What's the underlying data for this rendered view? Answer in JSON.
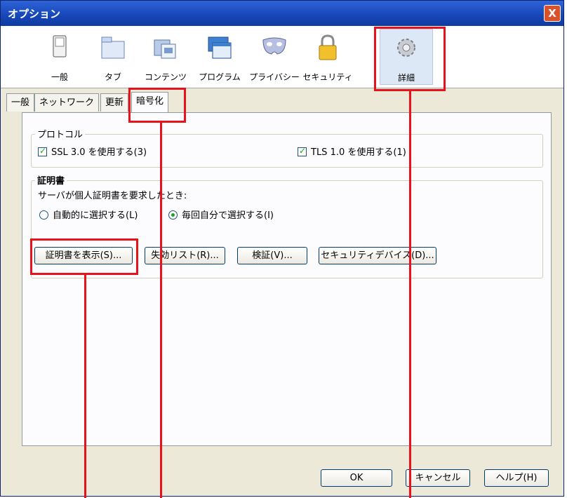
{
  "window": {
    "title": "オプション",
    "close_label": "X"
  },
  "toolbar": {
    "items": [
      {
        "label": "一般"
      },
      {
        "label": "タブ"
      },
      {
        "label": "コンテンツ"
      },
      {
        "label": "プログラム"
      },
      {
        "label": "プライバシー"
      },
      {
        "label": "セキュリティ"
      },
      {
        "label": "詳細"
      }
    ]
  },
  "subtabs": [
    {
      "label": "一般"
    },
    {
      "label": "ネットワーク"
    },
    {
      "label": "更新"
    },
    {
      "label": "暗号化"
    }
  ],
  "protocol": {
    "title": "プロトコル",
    "ssl_label": "SSL 3.0 を使用する(3)",
    "tls_label": "TLS 1.0 を使用する(1)"
  },
  "certificates": {
    "title": "証明書",
    "prompt": "サーバが個人証明書を要求したとき:",
    "auto_label": "自動的に選択する(L)",
    "ask_label": "毎回自分で選択する(I)",
    "buttons": {
      "show": "証明書を表示(S)...",
      "revocation": "失効リスト(R)...",
      "verify": "検証(V)...",
      "devices": "セキュリティデバイス(D)..."
    }
  },
  "footer": {
    "ok": "OK",
    "cancel": "キャンセル",
    "help": "ヘルプ(H)"
  },
  "colors": {
    "highlight": "#e8121b",
    "titlebar": "#1746b7"
  }
}
